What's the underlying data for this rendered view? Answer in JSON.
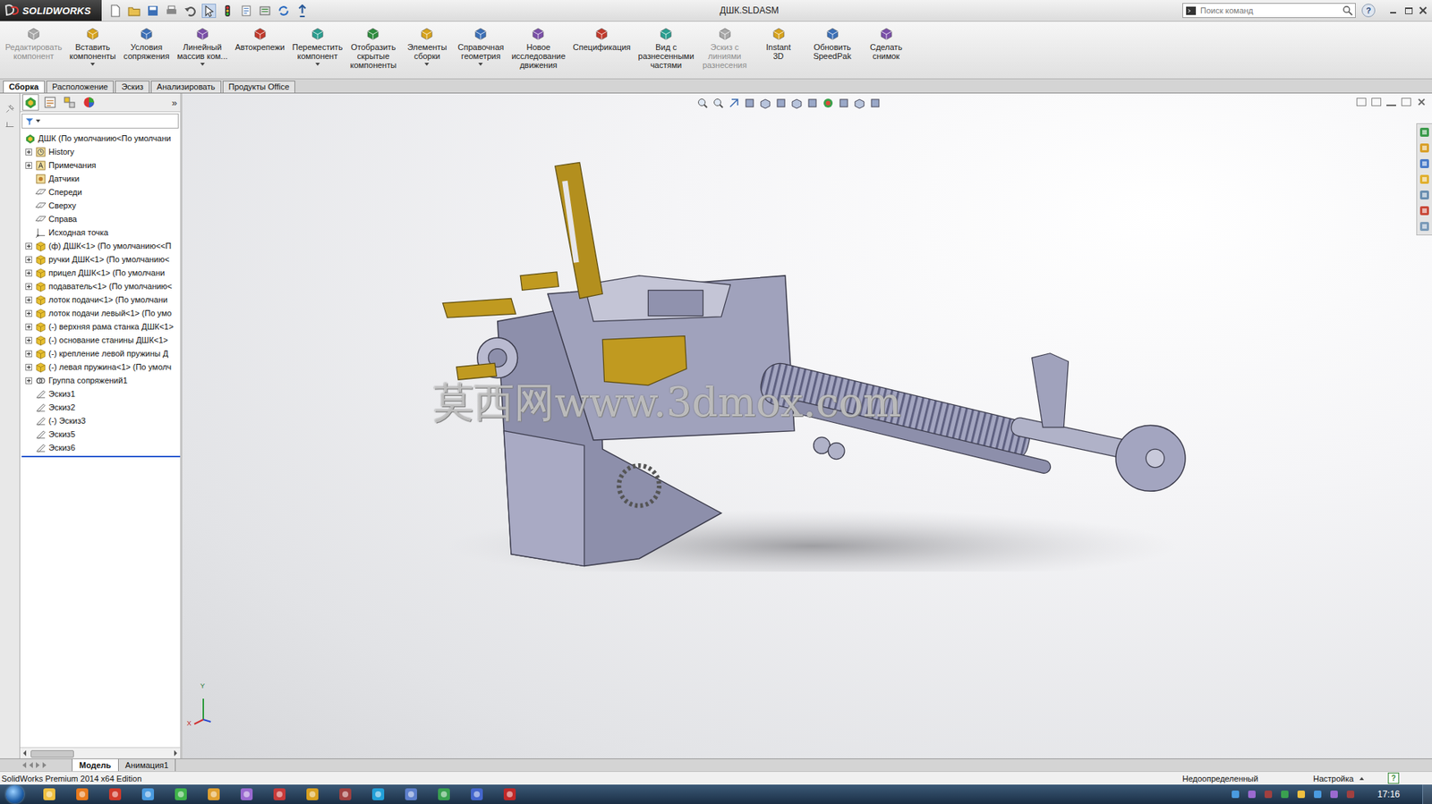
{
  "window": {
    "title": "ДШК.SLDASM",
    "app": "SOLIDWORKS"
  },
  "search": {
    "placeholder": "Поиск команд"
  },
  "help": "?",
  "ribbon": [
    {
      "lines": [
        "Редактировать",
        "компонент"
      ],
      "disabled": true,
      "dropdown": false
    },
    {
      "lines": [
        "Вставить",
        "компоненты"
      ],
      "disabled": false,
      "dropdown": true
    },
    {
      "lines": [
        "Условия",
        "сопряжения"
      ],
      "disabled": false,
      "dropdown": false
    },
    {
      "lines": [
        "Линейный",
        "массив ком..."
      ],
      "disabled": false,
      "dropdown": true
    },
    {
      "lines": [
        "Автокрепежи"
      ],
      "disabled": false,
      "dropdown": false
    },
    {
      "lines": [
        "Переместить",
        "компонент"
      ],
      "disabled": false,
      "dropdown": true
    },
    {
      "lines": [
        "Отобразить",
        "скрытые",
        "компоненты"
      ],
      "disabled": false,
      "dropdown": false
    },
    {
      "lines": [
        "Элементы",
        "сборки"
      ],
      "disabled": false,
      "dropdown": true
    },
    {
      "lines": [
        "Справочная",
        "геометрия"
      ],
      "disabled": false,
      "dropdown": true
    },
    {
      "lines": [
        "Новое",
        "исследование",
        "движения"
      ],
      "disabled": false,
      "dropdown": false
    },
    {
      "lines": [
        "Спецификация"
      ],
      "disabled": false,
      "dropdown": false
    },
    {
      "lines": [
        "Вид с",
        "разнесенными",
        "частями"
      ],
      "disabled": false,
      "dropdown": false
    },
    {
      "lines": [
        "Эскиз с",
        "линиями",
        "разнесения"
      ],
      "disabled": true,
      "dropdown": false
    },
    {
      "lines": [
        "Instant",
        "3D"
      ],
      "disabled": false,
      "dropdown": false
    },
    {
      "lines": [
        "Обновить",
        "SpeedPak"
      ],
      "disabled": false,
      "dropdown": false
    },
    {
      "lines": [
        "Сделать",
        "снимок"
      ],
      "disabled": false,
      "dropdown": false
    }
  ],
  "tabs": [
    {
      "label": "Сборка",
      "selected": true
    },
    {
      "label": "Расположение",
      "selected": false
    },
    {
      "label": "Эскиз",
      "selected": false
    },
    {
      "label": "Анализировать",
      "selected": false
    },
    {
      "label": "Продукты Office",
      "selected": false
    }
  ],
  "tree": {
    "expand_glyph": "»",
    "items": [
      {
        "label": "ДШК  (По умолчанию<По умолчани",
        "kind": "assembly",
        "expandable": false,
        "expanded": false
      },
      {
        "label": "History",
        "kind": "history",
        "expandable": true,
        "expanded": false
      },
      {
        "label": "Примечания",
        "kind": "annotations",
        "expandable": true,
        "expanded": false
      },
      {
        "label": "Датчики",
        "kind": "sensors",
        "expandable": false,
        "expanded": false
      },
      {
        "label": "Спереди",
        "kind": "plane",
        "expandable": false,
        "expanded": false
      },
      {
        "label": "Сверху",
        "kind": "plane",
        "expandable": false,
        "expanded": false
      },
      {
        "label": "Справа",
        "kind": "plane",
        "expandable": false,
        "expanded": false
      },
      {
        "label": "Исходная точка",
        "kind": "origin",
        "expandable": false,
        "expanded": false
      },
      {
        "label": "(ф) ДШК<1> (По умолчанию<<П",
        "kind": "part",
        "expandable": true,
        "expanded": false
      },
      {
        "label": "ручки ДШК<1> (По умолчанию<",
        "kind": "part",
        "expandable": true,
        "expanded": false
      },
      {
        "label": "прицел ДШК<1> (По умолчани",
        "kind": "part",
        "expandable": true,
        "expanded": false
      },
      {
        "label": "подаватель<1> (По умолчанию<",
        "kind": "part",
        "expandable": true,
        "expanded": false
      },
      {
        "label": "лоток подачи<1> (По умолчани",
        "kind": "part",
        "expandable": true,
        "expanded": false
      },
      {
        "label": "лоток подачи левый<1> (По умо",
        "kind": "part",
        "expandable": true,
        "expanded": false
      },
      {
        "label": "(-) верхняя рама станка ДШК<1>",
        "kind": "part",
        "expandable": true,
        "expanded": false
      },
      {
        "label": "(-) основание станины ДШК<1>",
        "kind": "part",
        "expandable": true,
        "expanded": false
      },
      {
        "label": "(-) крепление левой пружины Д",
        "kind": "part",
        "expandable": true,
        "expanded": false
      },
      {
        "label": "(-) левая пружина<1> (По умолч",
        "kind": "part",
        "expandable": true,
        "expanded": false
      },
      {
        "label": "Группа сопряжений1",
        "kind": "mates",
        "expandable": true,
        "expanded": false
      },
      {
        "label": "Эскиз1",
        "kind": "sketch",
        "expandable": false,
        "expanded": false
      },
      {
        "label": "Эскиз2",
        "kind": "sketch",
        "expandable": false,
        "expanded": false
      },
      {
        "label": "(-) Эскиз3",
        "kind": "sketch",
        "expandable": false,
        "expanded": false
      },
      {
        "label": "Эскиз5",
        "kind": "sketch",
        "expandable": false,
        "expanded": false
      },
      {
        "label": "Эскиз6",
        "kind": "sketch",
        "expandable": false,
        "expanded": false
      }
    ]
  },
  "watermark": "莫西网www.3dmox.com",
  "triad": [
    "Y",
    "X"
  ],
  "bottom_tabs": [
    {
      "label": "Модель",
      "selected": true
    },
    {
      "label": "Анимация1",
      "selected": false
    }
  ],
  "status_bar": {
    "edition": "SolidWorks Premium 2014 x64 Edition",
    "state": "Недоопределенный",
    "units": "Настройка",
    "help": "?"
  },
  "taskbar": {
    "time": "17:16"
  }
}
